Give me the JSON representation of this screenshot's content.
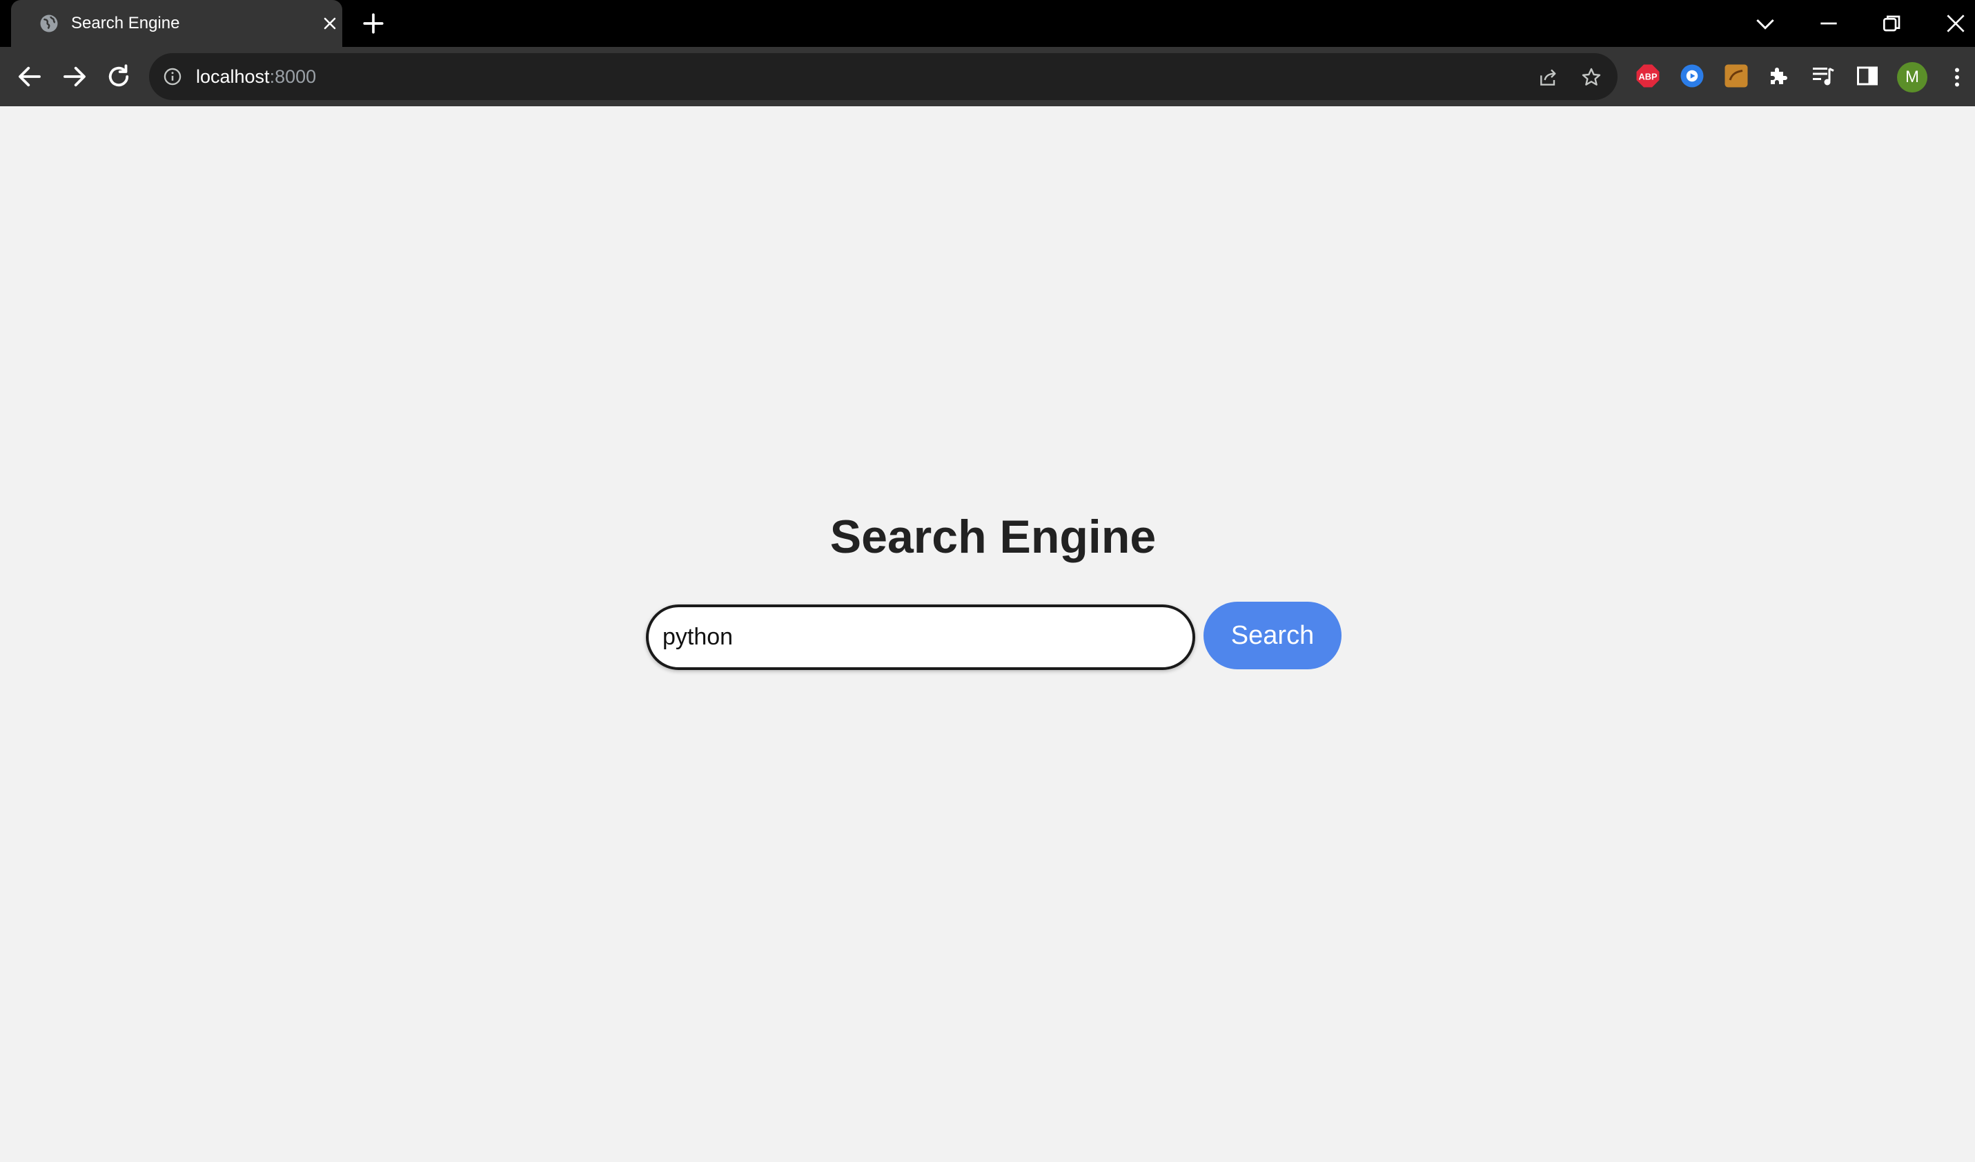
{
  "browser": {
    "tab": {
      "title": "Search Engine"
    },
    "address": {
      "host": "localhost",
      "port": ":8000"
    },
    "icons": {
      "favicon": "globe-icon",
      "tab_close": "close-icon",
      "new_tab": "plus-icon",
      "tab_search": "chevron-down-icon",
      "minimize": "minimize-icon",
      "restore": "restore-icon",
      "close_window": "close-icon",
      "back": "arrow-left-icon",
      "forward": "arrow-right-icon",
      "reload": "reload-icon",
      "site_info": "info-icon",
      "share": "share-icon",
      "bookmark": "star-icon",
      "extensions": "puzzle-icon",
      "reading_list": "reading-list-icon",
      "side_panel": "side-panel-icon",
      "menu": "kebab-icon"
    },
    "extensions": [
      {
        "name": "adblock-plus",
        "label": "ABP",
        "color": "#e3283c"
      },
      {
        "name": "screen-recorder",
        "label": "",
        "color": "#2b7de9"
      },
      {
        "name": "extension-orange",
        "label": "",
        "color": "#c8862b"
      }
    ],
    "profile": {
      "initial": "M",
      "color": "#5b8f29"
    }
  },
  "page": {
    "title": "Search Engine",
    "search": {
      "value": "python",
      "placeholder": ""
    },
    "button_label": "Search",
    "accent": "#4f86ec",
    "background": "#f2f2f2"
  }
}
